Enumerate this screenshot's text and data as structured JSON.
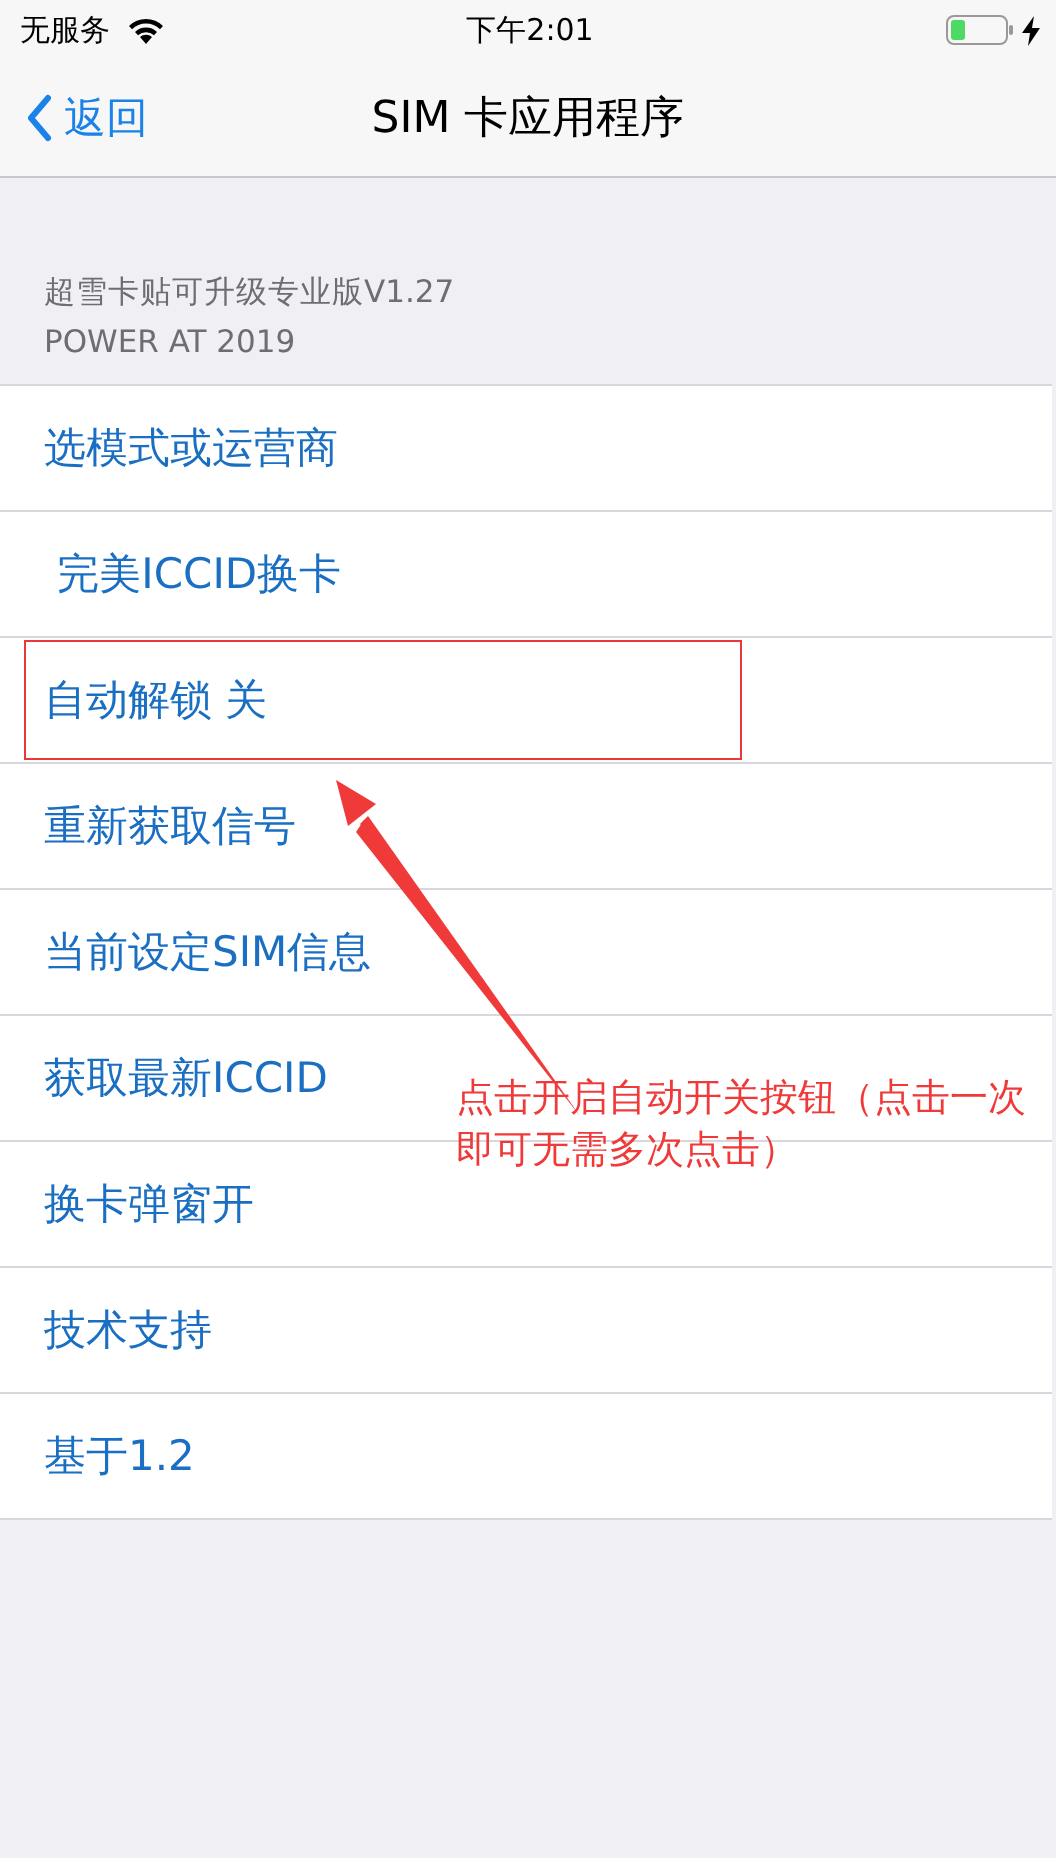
{
  "status_bar": {
    "carrier": "无服务",
    "time": "下午2:01"
  },
  "nav": {
    "back": "返回",
    "title": "SIM 卡应用程序"
  },
  "header": {
    "lines": [
      "超雪卡贴可升级专业版V1.27",
      "POWER AT 2019"
    ]
  },
  "items": [
    {
      "label": "选模式或运营商"
    },
    {
      "label": " 完美ICCID换卡"
    },
    {
      "label": "自动解锁 关",
      "highlighted": true
    },
    {
      "label": "重新获取信号"
    },
    {
      "label": "当前设定SIM信息"
    },
    {
      "label": "获取最新ICCID"
    },
    {
      "label": "换卡弹窗开"
    },
    {
      "label": "技术支持"
    },
    {
      "label": "基于1.2"
    }
  ],
  "annotation": {
    "text": "点击开启自动开关按钮（点击一次即可无需多次点击）"
  }
}
